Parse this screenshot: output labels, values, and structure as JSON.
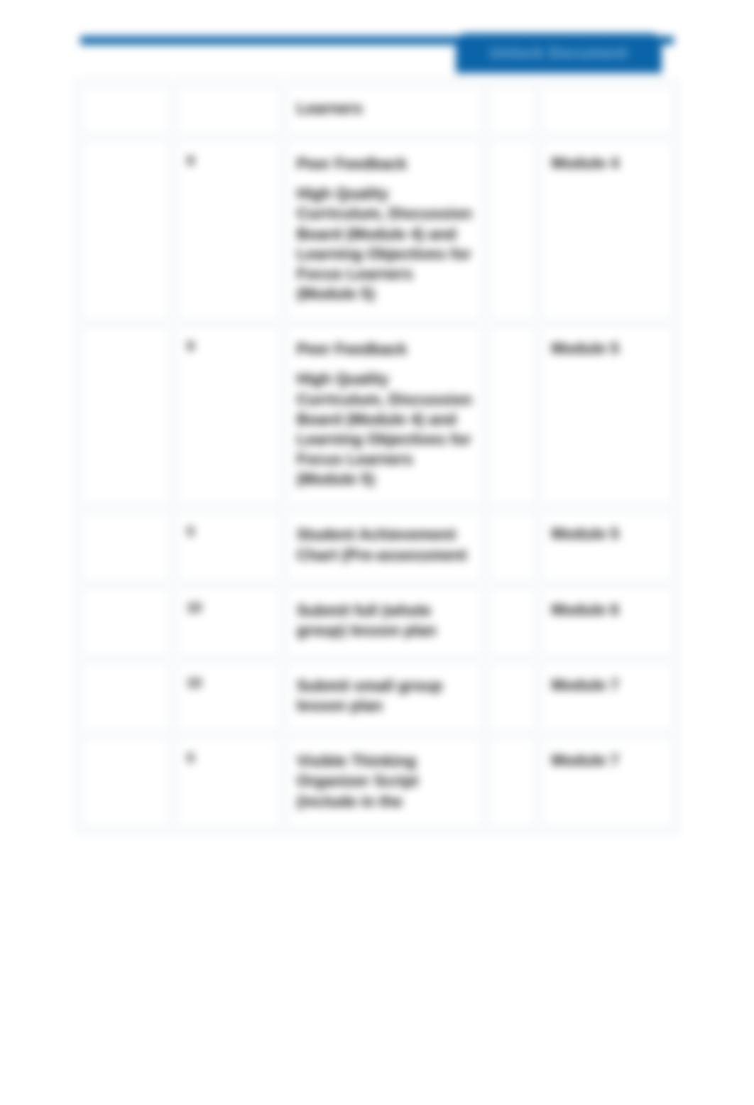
{
  "header": {
    "tab_label": "Unlock Document"
  },
  "rows": [
    {
      "col1": "",
      "col2": "",
      "title": "",
      "desc": "Learners",
      "col4": "",
      "module": ""
    },
    {
      "col1": "",
      "col2": "9",
      "title": "Peer Feedback",
      "desc": "High Quality Curriculum, Discussion Board (Module 4) and Learning Objectives for Focus Learners (Module 5)",
      "col4": "",
      "module": "Module 4"
    },
    {
      "col1": "",
      "col2": "9",
      "title": "Peer Feedback",
      "desc": "High Quality Curriculum, Discussion Board (Module 4) and Learning Objectives for Focus Learners (Module 5)",
      "col4": "",
      "module": "Module 5"
    },
    {
      "col1": "",
      "col2": "5",
      "title": "",
      "desc": "Student Achievement Chart (Pre-assessment",
      "col4": "",
      "module": "Module 5"
    },
    {
      "col1": "",
      "col2": "10",
      "title": "",
      "desc": "Submit full (whole group) lesson plan",
      "col4": "",
      "module": "Module 6"
    },
    {
      "col1": "",
      "col2": "10",
      "title": "",
      "desc": "Submit small group lesson plan",
      "col4": "",
      "module": "Module 7"
    },
    {
      "col1": "",
      "col2": "5",
      "title": "",
      "desc": "Visible Thinking Organizer Script (include in the",
      "col4": "",
      "module": "Module 7"
    }
  ]
}
